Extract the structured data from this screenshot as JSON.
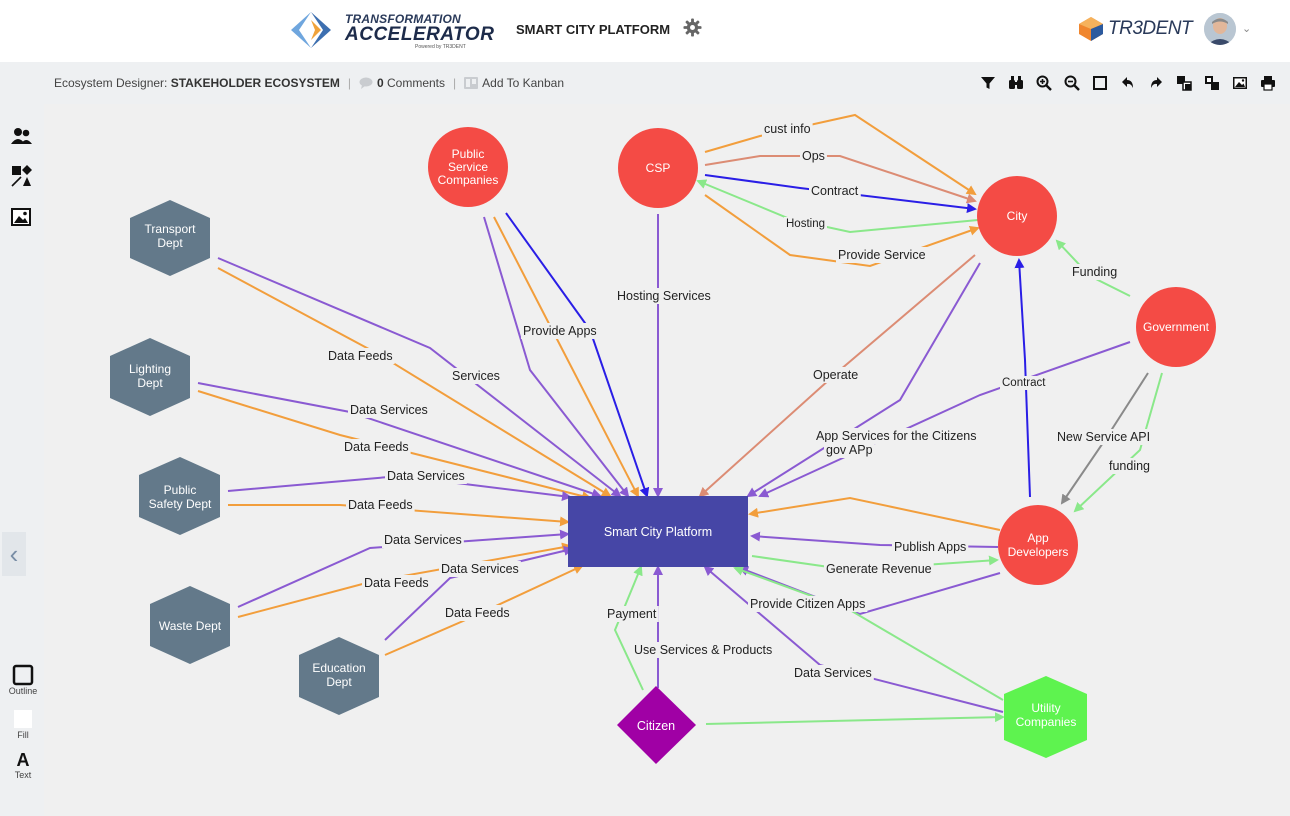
{
  "header": {
    "logo_line1": "TRANSFORMATION",
    "logo_line2": "ACCELERATOR",
    "logo_line3": "Powered by TR3DENT",
    "app_title": "SMART CITY PLATFORM",
    "brand_name": "TR3DENT"
  },
  "subbar": {
    "designer_prefix": "Ecosystem Designer:",
    "designer_name": "STAKEHOLDER ECOSYSTEM",
    "comments_count": "0",
    "comments_label": "Comments",
    "kanban_label": "Add To Kanban"
  },
  "toolbar": [
    "filter-icon",
    "binoculars-icon",
    "zoom-in-icon",
    "zoom-out-icon",
    "fit-square-icon",
    "undo-icon",
    "redo-icon",
    "bring-front-icon",
    "send-back-icon",
    "image-icon",
    "print-icon"
  ],
  "left_rail": {
    "outline_label": "Outline",
    "fill_label": "Fill",
    "text_glyph": "A",
    "text_label": "Text"
  },
  "colors": {
    "circle_red": "#f44b45",
    "hex_gray": "#63798a",
    "platform_blue": "#4646a6",
    "citizen_purple": "#a000a5",
    "utility_green": "#5ef34f",
    "edge_purple": "#8a5ad2",
    "edge_orange": "#f29e3c",
    "edge_blue": "#2a1ee6",
    "edge_salmon": "#dc8c74",
    "edge_green": "#8ae88a",
    "edge_gray": "#8a8a8a"
  },
  "diagram": {
    "nodes": {
      "platform": {
        "lines": [
          "Smart City Platform"
        ]
      },
      "psc": {
        "lines": [
          "Public",
          "Service",
          "Companies"
        ]
      },
      "csp": {
        "lines": [
          "CSP"
        ]
      },
      "city": {
        "lines": [
          "City"
        ]
      },
      "government": {
        "lines": [
          "Government"
        ]
      },
      "appdev": {
        "lines": [
          "App",
          "Developers"
        ]
      },
      "citizen": {
        "lines": [
          "Citizen"
        ]
      },
      "utility": {
        "lines": [
          "Utility",
          "Companies"
        ]
      },
      "transport": {
        "lines": [
          "Transport",
          "Dept"
        ]
      },
      "lighting": {
        "lines": [
          "Lighting",
          "Dept"
        ]
      },
      "safety": {
        "lines": [
          "Public",
          "Safety Dept"
        ]
      },
      "waste": {
        "lines": [
          "Waste Dept"
        ]
      },
      "education": {
        "lines": [
          "Education",
          "Dept"
        ]
      }
    },
    "edge_labels": {
      "cust_info": "cust info",
      "ops": "Ops",
      "contract_csp": "Contract",
      "hosting": "Hosting",
      "provide_service": "Provide Service",
      "funding": "Funding",
      "hosting_services": "Hosting Services",
      "provide_apps": "Provide Apps",
      "services": "Services",
      "data_feeds_transport": "Data Feeds",
      "data_services_lighting": "Data Services",
      "data_feeds_lighting": "Data Feeds",
      "data_services_safety": "Data Services",
      "data_feeds_safety": "Data Feeds",
      "data_services_waste": "Data Services",
      "data_feeds_waste": "Data Feeds",
      "data_services_education": "Data Services",
      "data_feeds_education": "Data Feeds",
      "operate": "Operate",
      "contract_appdev": "Contract",
      "app_services_citizens": "App Services for the Citizens",
      "gov_app": "gov APp",
      "new_service_api": "New Service API",
      "funding_gov": "funding",
      "publish_apps": "Publish Apps",
      "generate_revenue": "Generate Revenue",
      "provide_citizen_apps": "Provide Citizen Apps",
      "payment": "Payment",
      "use_services": "Use Services & Products",
      "data_services_utility": "Data Services"
    }
  }
}
